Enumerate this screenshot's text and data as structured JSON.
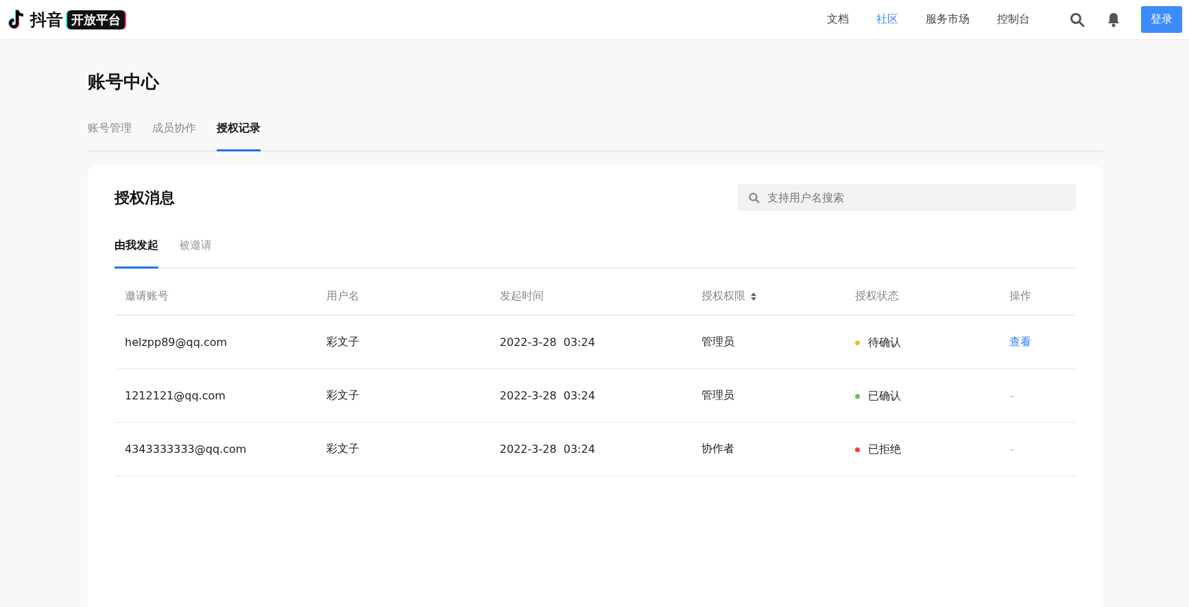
{
  "header": {
    "logo_text": "抖音",
    "logo_badge": "开放平台",
    "nav": [
      {
        "label": "文档",
        "selected": false
      },
      {
        "label": "社区",
        "selected": true
      },
      {
        "label": "服务市场",
        "selected": false
      },
      {
        "label": "控制台",
        "selected": false
      }
    ],
    "login_button": "登录"
  },
  "page_title": "账号中心",
  "tabs": [
    {
      "label": "账号管理",
      "selected": false
    },
    {
      "label": "成员协作",
      "selected": false
    },
    {
      "label": "授权记录",
      "selected": true
    }
  ],
  "card": {
    "title": "授权消息",
    "search": {
      "placeholder": "支持用户名搜索"
    },
    "subtabs": [
      {
        "label": "由我发起",
        "selected": true
      },
      {
        "label": "被邀请",
        "selected": false
      }
    ],
    "table": {
      "columns": [
        {
          "label": "邀请账号",
          "sortable": false
        },
        {
          "label": "用户名",
          "sortable": false
        },
        {
          "label": "发起时间",
          "sortable": false
        },
        {
          "label": "授权权限",
          "sortable": true
        },
        {
          "label": "授权状态",
          "sortable": false
        },
        {
          "label": "操作",
          "sortable": false
        }
      ],
      "rows": [
        {
          "account": "helzpp89@qq.com",
          "username": "彩文子",
          "time": "2022-3-28  03:24",
          "permission": "管理员",
          "status": {
            "text": "待确认",
            "color": "#f7b52c"
          },
          "action": {
            "text": "查看",
            "kind": "link"
          }
        },
        {
          "account": "1212121@qq.com",
          "username": "彩文子",
          "time": "2022-3-28  03:24",
          "permission": "管理员",
          "status": {
            "text": "已确认",
            "color": "#5cc165"
          },
          "action": {
            "text": "–",
            "kind": "none"
          }
        },
        {
          "account": "4343333333@qq.com",
          "username": "彩文子",
          "time": "2022-3-28  03:24",
          "permission": "协作者",
          "status": {
            "text": "已拒绝",
            "color": "#f5432c"
          },
          "action": {
            "text": "–",
            "kind": "none"
          }
        }
      ]
    }
  }
}
